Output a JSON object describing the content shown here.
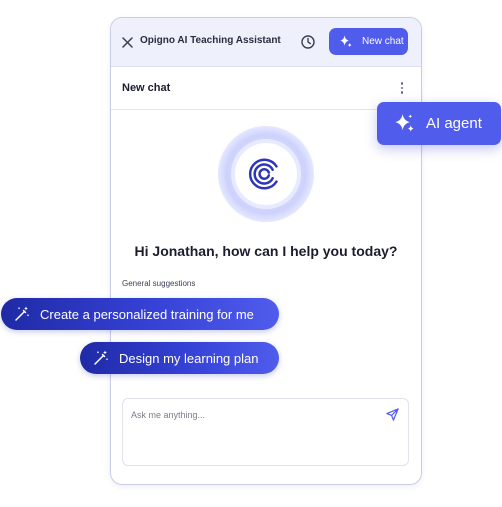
{
  "window": {
    "title": "Opigno AI Teaching Assistant",
    "new_chat_label": "New chat",
    "icons": {
      "close": "close-icon",
      "history": "clock-icon",
      "sparkle": "sparkle-icon"
    }
  },
  "chat": {
    "title": "New chat",
    "greeting": "Hi Jonathan, how can I help you today?",
    "suggestions_label": "General suggestions",
    "input_placeholder": "Ask me anything..."
  },
  "badge": {
    "label": "AI agent"
  },
  "suggestions": [
    {
      "label": "Create a personalized training for me",
      "icon": "magic-wand-icon"
    },
    {
      "label": "Design my learning plan",
      "icon": "magic-wand-icon"
    }
  ],
  "colors": {
    "accent": "#4F5CEC",
    "chip_dark": "#1F2AA6",
    "header_bg": "#EEF0FB"
  }
}
